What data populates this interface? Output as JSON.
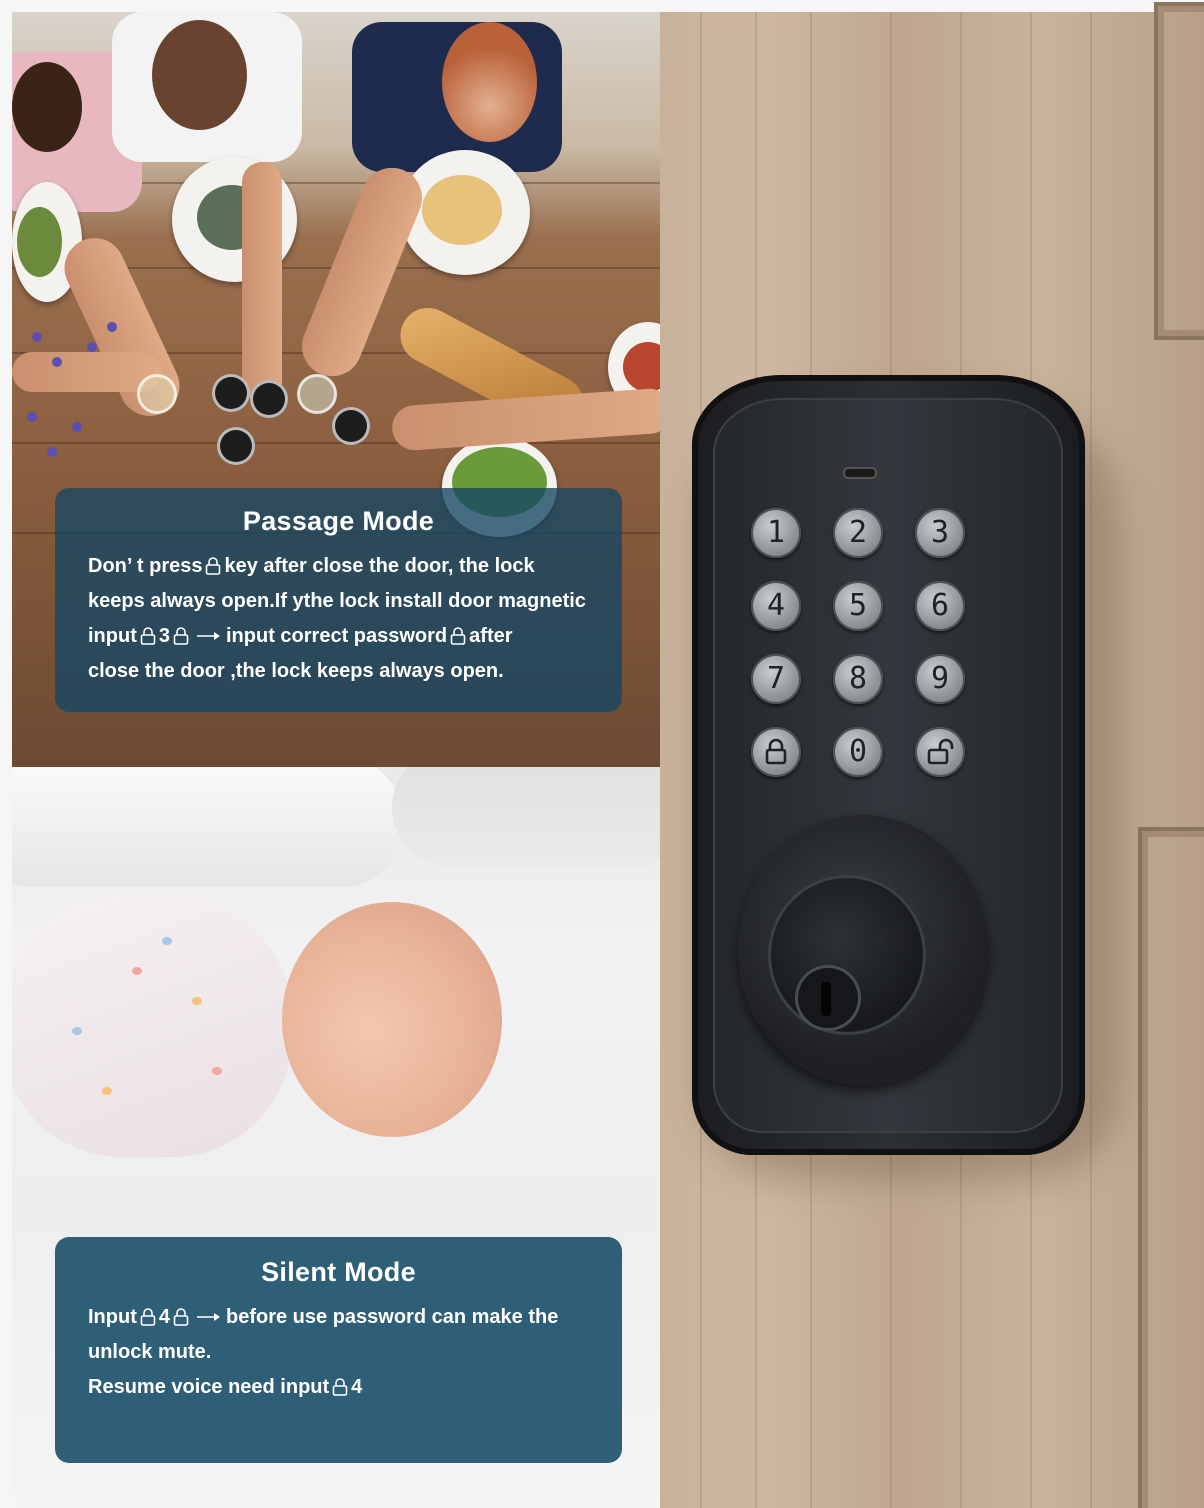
{
  "passage_mode": {
    "title": "Passage Mode",
    "line1_a": "Don’ t press",
    "line1_b": "key after close the door, the lock",
    "line2": "keeps always open.If ythe lock install door magnetic",
    "line3_a": "input",
    "line3_b": "3",
    "line3_c": "input correct password",
    "line3_d": "after",
    "line4": "close the door ,the lock keeps always open."
  },
  "silent_mode": {
    "title": "Silent Mode",
    "line1_a": "Input",
    "line1_b": "4",
    "line1_c": "before use password can make the",
    "line2": "unlock mute.",
    "line3_a": "Resume voice need input",
    "line3_b": "4"
  },
  "keypad": {
    "keys": [
      "1",
      "2",
      "3",
      "4",
      "5",
      "6",
      "7",
      "8",
      "9",
      "0"
    ],
    "lock_key_icon": "lock-closed-icon",
    "unlock_key_icon": "lock-open-icon"
  },
  "colors": {
    "card_passage": "#14466480",
    "card_silent": "#1e526c",
    "lock_body": "#2c2f34",
    "door_wood": "#c8b29b"
  }
}
